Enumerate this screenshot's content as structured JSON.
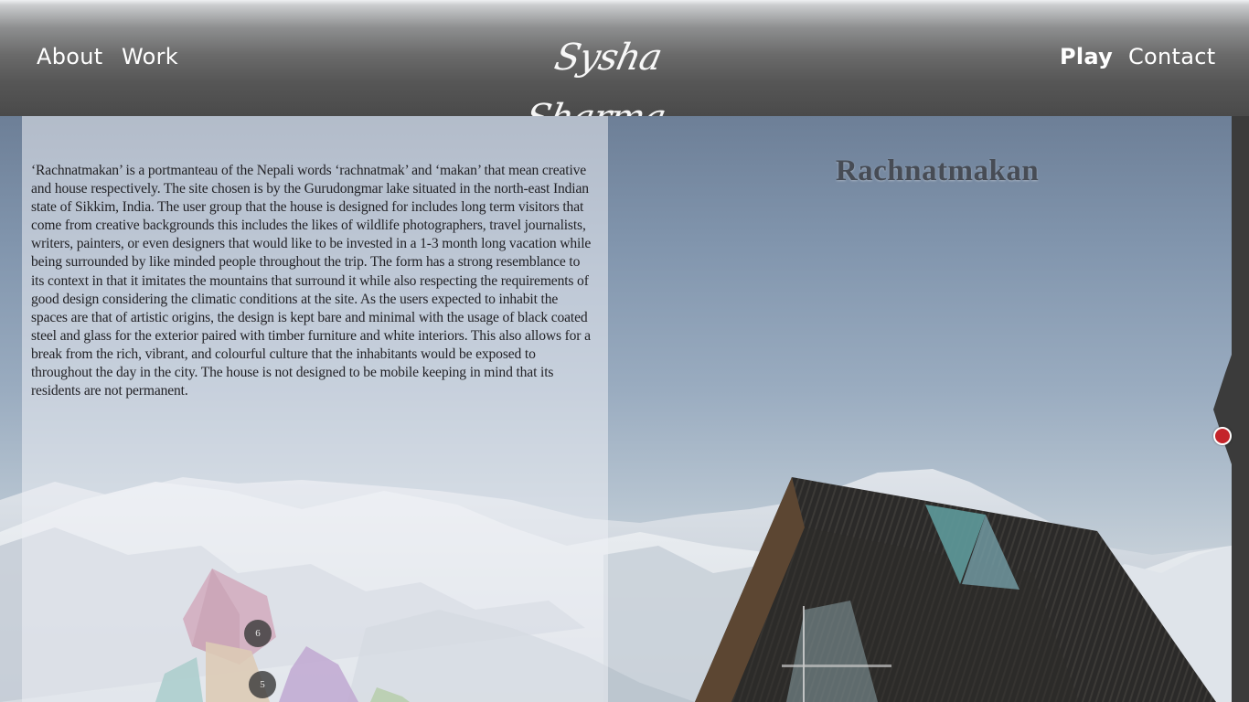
{
  "header": {
    "nav_left": [
      "About",
      "Work"
    ],
    "nav_right": [
      "Play",
      "Contact"
    ],
    "active": "Play",
    "logo_text": "Sysha Sharma"
  },
  "project": {
    "title": "Rachnatmakan",
    "description": "‘Rachnatmakan’ is a portmanteau of the Nepali words ‘rachnatmak’ and ‘makan’ that mean creative and house respectively. The site chosen is by the Gurudongmar lake situated in the north-east Indian state of Sikkim, India. The user group that the house is designed for includes long term visitors that come from creative backgrounds this includes the likes of wildlife photographers, travel journalists, writers, painters, or even designers that would like to be invested in a 1-3 month long vacation while being surrounded by like minded people throughout the trip. The form has a strong resemblance to its context in that it imitates the mountains that surround it while also respecting the requirements of good design considering the climatic conditions at the site. As the users expected to inhabit the spaces are that of artistic origins, the design is kept bare and minimal with the usage of black coated steel and glass for the exterior paired with timber furniture and white interiors. This also allows for a break from the rich, vibrant, and colourful culture that the inhabitants would be exposed to throughout the day in the city. The house is not designed to be mobile keeping in mind that its residents are not permanent."
  },
  "diagram_badges": [
    "6",
    "5"
  ],
  "colors": {
    "accent_dot": "#c4242a",
    "header_dark": "#4a4a4a",
    "title_text": "#474c55"
  }
}
